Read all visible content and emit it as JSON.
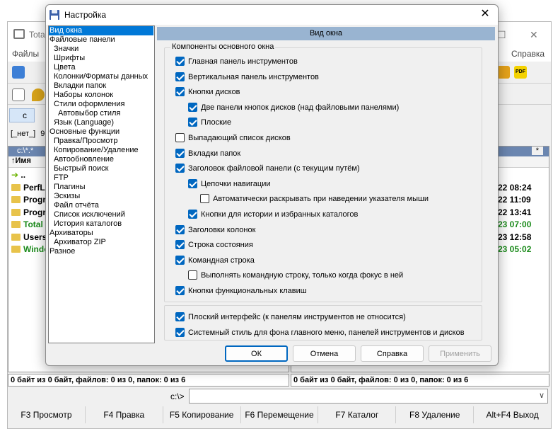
{
  "background_window": {
    "title": "Total",
    "menu_left": "Файлы",
    "menu_right": "Справка",
    "drive_button": "c",
    "drive_label": "[_нет_]",
    "drive_free": "9",
    "left_path": "c:\\*.*",
    "right_path_glyphs": "*",
    "col_name": "Имя",
    "up_dir": "..",
    "files": [
      {
        "name": "PerfLo",
        "green": false
      },
      {
        "name": "Progra",
        "green": false
      },
      {
        "name": "Progra",
        "green": false
      },
      {
        "name": "Total",
        "green": true
      },
      {
        "name": "Users",
        "green": false
      },
      {
        "name": "Windo",
        "green": true
      }
    ],
    "right_times": [
      {
        "text": "22 08:24",
        "green": false
      },
      {
        "text": "22 11:09",
        "green": false
      },
      {
        "text": "22 13:41",
        "green": false
      },
      {
        "text": "23 07:00",
        "green": true
      },
      {
        "text": "23 12:58",
        "green": false
      },
      {
        "text": "23 05:02",
        "green": true
      }
    ],
    "status_left": "0 байт из 0 байт, файлов: 0 из 0, папок: 0 из 6",
    "status_right": "0 байт из 0 байт, файлов: 0 из 0, папок: 0 из 6",
    "cmd_prompt": "c:\\>",
    "fkeys": [
      "F3 Просмотр",
      "F4 Правка",
      "F5 Копирование",
      "F6 Перемещение",
      "F7 Каталог",
      "F8 Удаление",
      "Alt+F4 Выход"
    ]
  },
  "dialog": {
    "title": "Настройка",
    "close_glyph": "✕",
    "tree": [
      {
        "label": "Вид окна",
        "indent": 0,
        "selected": true
      },
      {
        "label": "Файловые панели",
        "indent": 0
      },
      {
        "label": "Значки",
        "indent": 1
      },
      {
        "label": "Шрифты",
        "indent": 1
      },
      {
        "label": "Цвета",
        "indent": 1
      },
      {
        "label": "Колонки/Форматы данных",
        "indent": 1
      },
      {
        "label": "Вкладки папок",
        "indent": 1
      },
      {
        "label": "Наборы колонок",
        "indent": 1
      },
      {
        "label": "Стили оформления",
        "indent": 1
      },
      {
        "label": "Автовыбор стиля",
        "indent": 2
      },
      {
        "label": "Язык (Language)",
        "indent": 1
      },
      {
        "label": "Основные функции",
        "indent": 0
      },
      {
        "label": "Правка/Просмотр",
        "indent": 1
      },
      {
        "label": "Копирование/Удаление",
        "indent": 1
      },
      {
        "label": "Автообновление",
        "indent": 1
      },
      {
        "label": "Быстрый поиск",
        "indent": 1
      },
      {
        "label": "FTP",
        "indent": 1
      },
      {
        "label": "Плагины",
        "indent": 1
      },
      {
        "label": "Эскизы",
        "indent": 1
      },
      {
        "label": "Файл отчёта",
        "indent": 1
      },
      {
        "label": "Список исключений",
        "indent": 1
      },
      {
        "label": "История каталогов",
        "indent": 1
      },
      {
        "label": "Архиваторы",
        "indent": 0
      },
      {
        "label": "Архиватор ZIP",
        "indent": 1
      },
      {
        "label": "Разное",
        "indent": 0
      }
    ],
    "section_header": "Вид окна",
    "group1_legend": "Компоненты основного окна",
    "options": [
      {
        "label": "Главная панель инструментов",
        "checked": true,
        "level": 0
      },
      {
        "label": "Вертикальная панель инструментов",
        "checked": true,
        "level": 0
      },
      {
        "label": "Кнопки дисков",
        "checked": true,
        "level": 0
      },
      {
        "label": "Две панели кнопок дисков (над файловыми панелями)",
        "checked": true,
        "level": 1
      },
      {
        "label": "Плоские",
        "checked": true,
        "level": 1
      },
      {
        "label": "Выпадающий список дисков",
        "checked": false,
        "level": 0
      },
      {
        "label": "Вкладки папок",
        "checked": true,
        "level": 0
      },
      {
        "label": "Заголовок файловой панели (с текущим путём)",
        "checked": true,
        "level": 0
      },
      {
        "label": "Цепочки навигации",
        "checked": true,
        "level": 1
      },
      {
        "label": "Автоматически раскрывать при наведении указателя мыши",
        "checked": false,
        "level": 2
      },
      {
        "label": "Кнопки для истории и избранных каталогов",
        "checked": true,
        "level": 1
      },
      {
        "label": "Заголовки колонок",
        "checked": true,
        "level": 0
      },
      {
        "label": "Строка состояния",
        "checked": true,
        "level": 0
      },
      {
        "label": "Командная строка",
        "checked": true,
        "level": 0
      },
      {
        "label": "Выполнять командную строку, только когда фокус в ней",
        "checked": false,
        "level": 1
      },
      {
        "label": "Кнопки функциональных клавиш",
        "checked": true,
        "level": 0
      }
    ],
    "options2": [
      {
        "label": "Плоский интерфейс (к панелям инструментов не относится)",
        "checked": true
      },
      {
        "label": "Системный стиль для фона главного меню, панелей инструментов и дисков",
        "checked": true
      }
    ],
    "buttons": {
      "ok": "ОК",
      "cancel": "Отмена",
      "help": "Справка",
      "apply": "Применить"
    }
  }
}
